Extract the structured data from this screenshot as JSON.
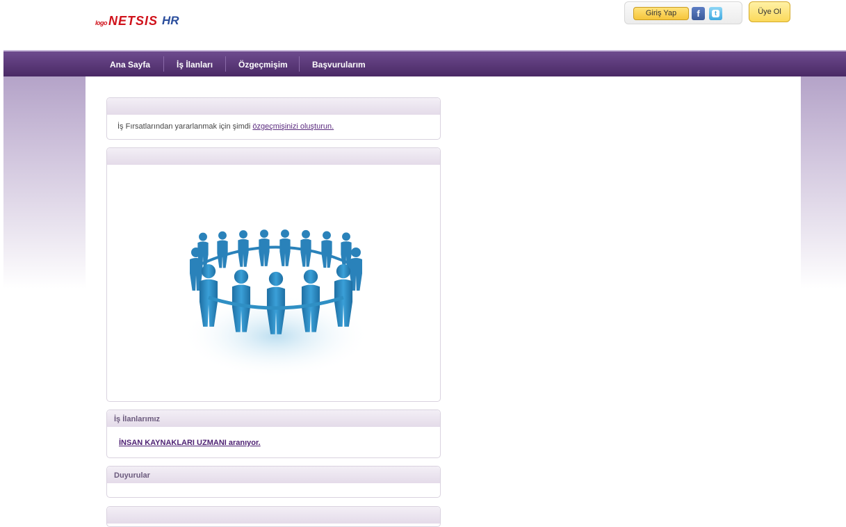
{
  "header": {
    "logo": {
      "prefix": "logo",
      "brand": "NETSIS",
      "suffix": "HR"
    },
    "login_label": "Giriş Yap",
    "facebook_glyph": "f",
    "twitter_glyph": "t",
    "signup_label": "Üye Ol"
  },
  "nav": {
    "items": [
      {
        "label": "Ana Sayfa"
      },
      {
        "label": "İş İlanları"
      },
      {
        "label": "Özgeçmişim"
      },
      {
        "label": "Başvurularım"
      }
    ]
  },
  "intro_panel": {
    "text": "İş Fırsatlarından yararlanmak için şimdi ",
    "link": "özgeçmişinizi oluşturun."
  },
  "jobs_panel": {
    "title": "İş İlanlarımız",
    "job_title": "İNSAN KAYNAKLARI UZMANI aranıyor."
  },
  "announcements_panel": {
    "title": "Duyurular"
  },
  "colors": {
    "nav": "#5a3577",
    "accent": "#4c1f72",
    "button_yellow": "#f6c53b",
    "people_blue": "#2f8fc4"
  }
}
